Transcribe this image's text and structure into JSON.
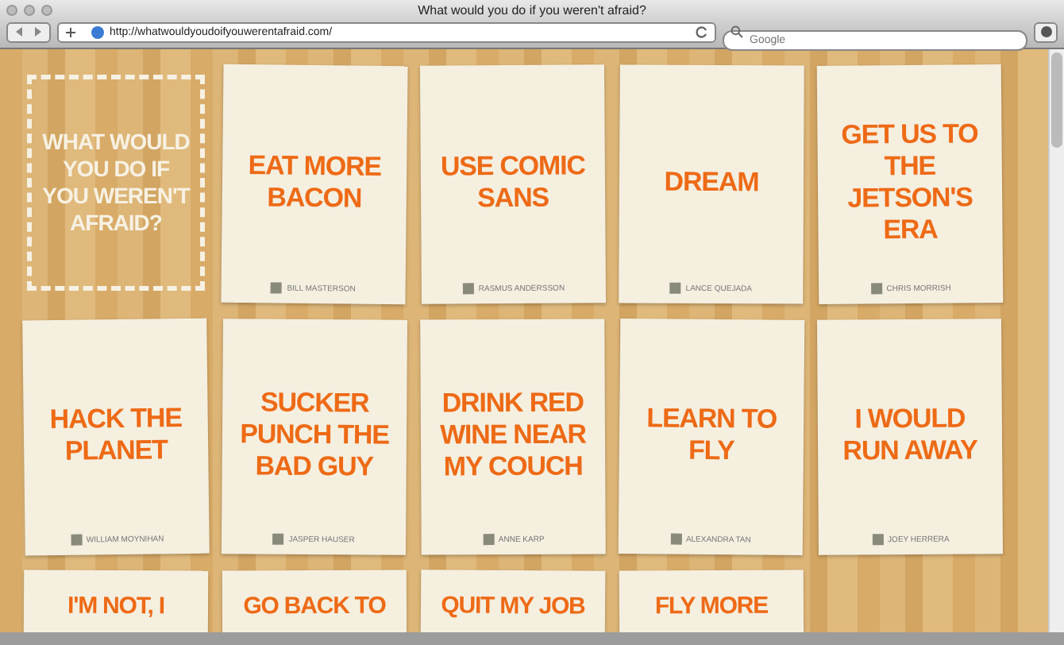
{
  "window": {
    "title": "What would you do if you weren't afraid?"
  },
  "toolbar": {
    "address": "http://whatwouldyoudoifyouwerentafraid.com/",
    "search": {
      "placeholder": "Google"
    }
  },
  "intro": {
    "text": "WHAT WOULD YOU DO IF YOU WEREN'T AFRAID?"
  },
  "cards": [
    {
      "text": "EAT MORE BACON",
      "author": "BILL MASTERSON"
    },
    {
      "text": "USE COMIC SANS",
      "author": "RASMUS ANDERSSON"
    },
    {
      "text": "DREAM",
      "author": "LANCE QUEJADA"
    },
    {
      "text": "GET US TO THE JETSON'S ERA",
      "author": "CHRIS MORRISH"
    },
    {
      "text": "HACK THE PLANET",
      "author": "WILLIAM MOYNIHAN"
    },
    {
      "text": "SUCKER PUNCH THE BAD GUY",
      "author": "JASPER HAUSER"
    },
    {
      "text": "DRINK RED WINE NEAR MY COUCH",
      "author": "ANNE KARP"
    },
    {
      "text": "LEARN TO FLY",
      "author": "ALEXANDRA TAN"
    },
    {
      "text": "I WOULD RUN AWAY",
      "author": "JOEY HERRERA"
    },
    {
      "text": "I'M NOT, I"
    },
    {
      "text": "GO BACK TO"
    },
    {
      "text": "QUIT MY JOB"
    },
    {
      "text": "FLY MORE"
    }
  ]
}
